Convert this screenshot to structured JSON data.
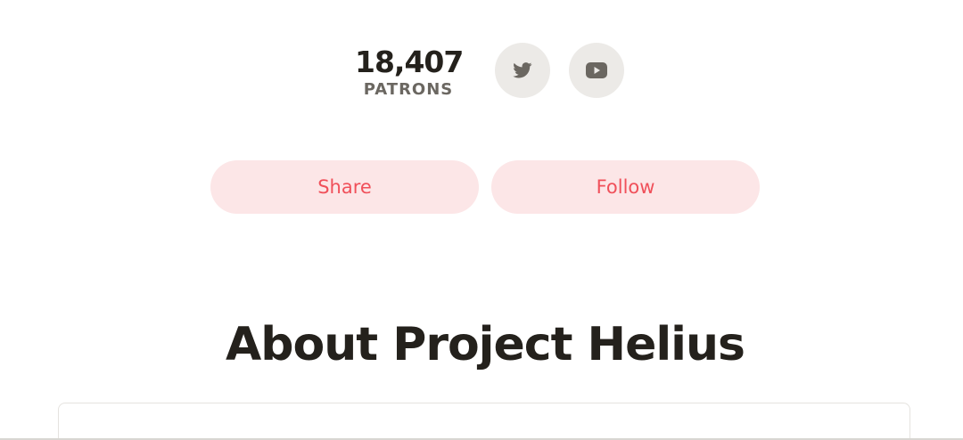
{
  "stats": {
    "patrons_count": "18,407",
    "patrons_label": "PATRONS"
  },
  "social": {
    "twitter_icon": "twitter-icon",
    "youtube_icon": "youtube-icon",
    "icon_color": "#6b6761",
    "bg_color": "#eceae7"
  },
  "actions": {
    "share_label": "Share",
    "follow_label": "Follow",
    "accent_color": "#f0505a",
    "button_bg": "#fce6e7"
  },
  "about": {
    "title": "About Project Helius"
  }
}
